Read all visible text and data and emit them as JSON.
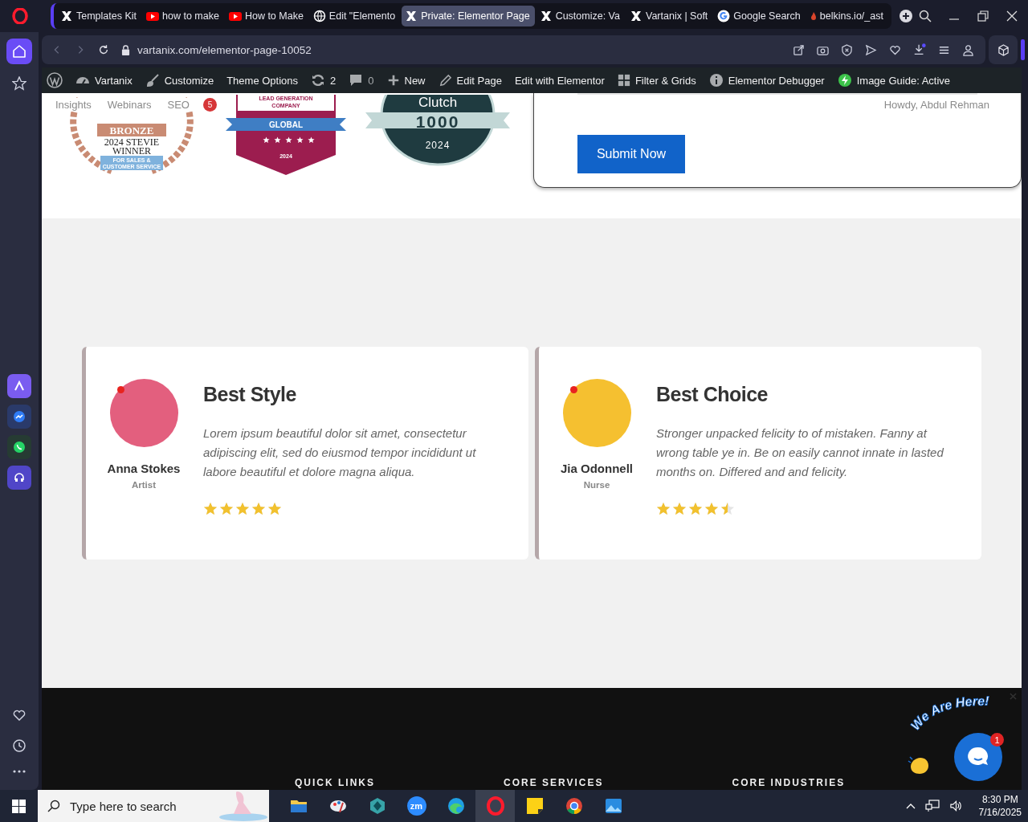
{
  "browser": {
    "tabs": [
      {
        "label": "Templates Kit",
        "kind": "site",
        "selected": false
      },
      {
        "label": "how to make",
        "kind": "video",
        "selected": false
      },
      {
        "label": "How to Make",
        "kind": "video",
        "selected": false
      },
      {
        "label": "Edit \"Elemento",
        "kind": "web",
        "selected": false
      },
      {
        "label": "Private: Elementor Page",
        "kind": "site",
        "selected": true
      },
      {
        "label": "Customize: Va",
        "kind": "site",
        "selected": false
      },
      {
        "label": "Vartanix | Soft",
        "kind": "site",
        "selected": false
      },
      {
        "label": "Google Search",
        "kind": "search",
        "selected": false
      },
      {
        "label": "belkins.io/_ast",
        "kind": "other",
        "selected": false
      }
    ],
    "url": "vartanix.com/elementor-page-10052"
  },
  "sidebar": {
    "items": [
      {
        "kind": "home",
        "selected": true
      },
      {
        "kind": "star",
        "selected": false
      }
    ]
  },
  "admin_bar": {
    "items": [
      {
        "kind": "wordpress"
      },
      {
        "kind": "dashboard",
        "label": "Vartanix"
      },
      {
        "kind": "brush",
        "label": "Customize"
      },
      {
        "kind": "none",
        "label": "Theme Options"
      },
      {
        "kind": "updates",
        "label": "2"
      },
      {
        "kind": "comments",
        "label": "0"
      },
      {
        "kind": "plus",
        "label": "New"
      },
      {
        "kind": "pencil",
        "label": "Edit Page"
      },
      {
        "kind": "none",
        "label": "Edit with Elementor"
      },
      {
        "kind": "grid",
        "label": "Filter & Grids"
      },
      {
        "kind": "info",
        "label": "Elementor Debugger"
      },
      {
        "kind": "bolt",
        "label": "Image Guide: Active"
      }
    ]
  },
  "page": {
    "ghost_nav": [
      "Insights",
      "Webinars",
      "SEO"
    ],
    "notification_count": "5",
    "greeting": "Howdy, Abdul Rehman",
    "awards": [
      {
        "kind": "stevie",
        "lines": [
          "BRONZE",
          "2024 STEVIE",
          "WINNER",
          "FOR SALES &",
          "CUSTOMER SERVICE"
        ]
      },
      {
        "kind": "ribbon",
        "lines": [
          "LEAD GENERATION",
          "COMPANY",
          "GLOBAL",
          "2024"
        ]
      },
      {
        "kind": "clutch",
        "lines": [
          "Clutch",
          "1000",
          "2024"
        ]
      }
    ],
    "form": {
      "submit": "Submit Now"
    },
    "testimonials": [
      {
        "name": "Anna Stokes",
        "role": "Artist",
        "title": "Best Style",
        "text": "Lorem ipsum beautiful dolor sit amet, consectetur adipiscing elit, sed do eiusmod tempor incididunt ut labore beautiful et dolore magna aliqua.",
        "stars": 5
      },
      {
        "name": "Jia Odonnell",
        "role": "Nurse",
        "title": "Best Choice",
        "text": "Stronger unpacked felicity to of mistaken. Fanny at wrong table ye in. Be on easily cannot innate in lasted months on. Differed and and felicity.",
        "stars": 4.5
      }
    ],
    "footer_headings": [
      "QUICK LINKS",
      "CORE SERVICES",
      "CORE INDUSTRIES"
    ],
    "chat": {
      "tagline": "We Are Here!",
      "unread": "1"
    }
  },
  "taskbar": {
    "search_placeholder": "Type here to search",
    "apps": [
      {
        "kind": "explorer",
        "selected": false
      },
      {
        "kind": "paint",
        "selected": false
      },
      {
        "kind": "gem",
        "selected": false
      },
      {
        "kind": "zoom",
        "label": "zm",
        "selected": false
      },
      {
        "kind": "edge",
        "selected": false
      },
      {
        "kind": "opera",
        "selected": true
      },
      {
        "kind": "notes",
        "selected": false
      },
      {
        "kind": "chrome",
        "selected": false
      },
      {
        "kind": "photos",
        "selected": false
      }
    ],
    "time": "8:30 PM",
    "date": "7/16/2025"
  }
}
